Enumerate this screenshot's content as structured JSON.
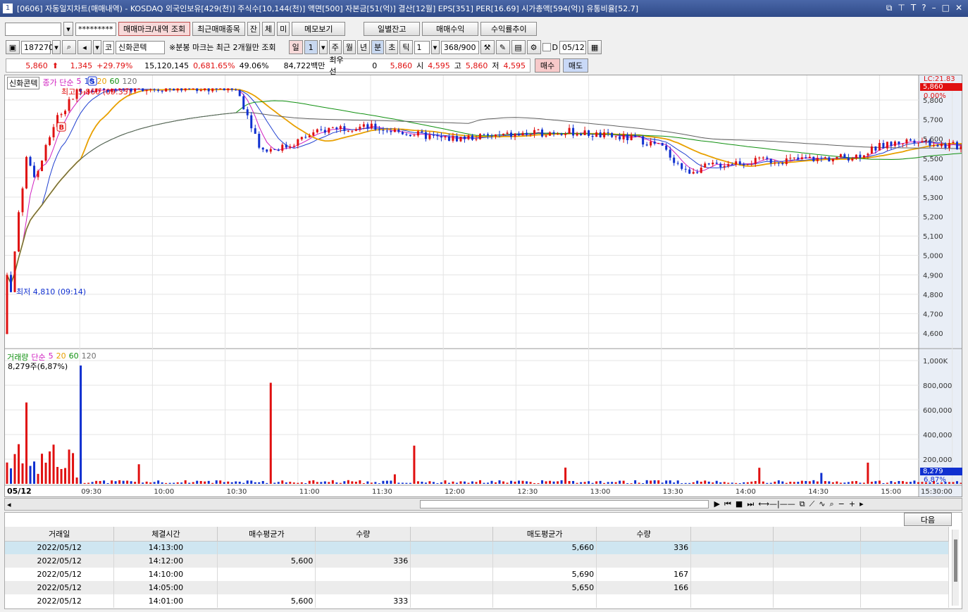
{
  "window": {
    "num": "1",
    "title": "[0606] 자동일지차트(매매내역) - KOSDAQ 외국인보유[429(천)] 주식수[10,144(천)] 액면[500] 자본금[51(억)] 결산[12월] EPS[351] PER[16.69] 시가총액[594(억)] 유통비율[52.7]"
  },
  "toolbar1": {
    "account": "",
    "password": "*********",
    "btn_mark": "매매마크/내역 조회",
    "btn_recent": "최근매매종목",
    "btn_jan": "잔",
    "btn_che": "체",
    "btn_mi": "미",
    "btn_memo": "메모보기",
    "btn_daily": "일별잔고",
    "btn_profit": "매매수익",
    "btn_rate": "수익률추이"
  },
  "toolbar2": {
    "code": "187270",
    "market": "코",
    "name": "신화콘텍",
    "note": "※분봉 마크는 최근 2개월만 조회",
    "periods": [
      "일",
      "1",
      "주",
      "월",
      "년",
      "분",
      "초",
      "틱"
    ],
    "interval": "1",
    "count": "368/900",
    "d_label": "D",
    "date": "05/12"
  },
  "quote": {
    "price": "5,860",
    "change": "1,345",
    "change_pct": "+29.79%",
    "volume": "15,120,145",
    "vol_pct": "0,681.65%",
    "turnover": "49.06%",
    "amount": "84,722백만",
    "best_label": "최우선",
    "best_qty": "0",
    "best_price": "5,860",
    "open_label": "시",
    "open": "4,595",
    "high_label": "고",
    "high": "5,860",
    "low_label": "저",
    "low": "4,595",
    "buy": "매수",
    "sell": "매도"
  },
  "chart": {
    "stock_label": "신화콘텍",
    "price_legend": "종가 단순",
    "ma": [
      "5",
      "10",
      "20",
      "60",
      "120"
    ],
    "high_note": "최고 5,860 (09:35)",
    "low_note": "최저 4,810 (09:14)",
    "lc_label": "LC:21.83",
    "last_price": "5,860",
    "last_pct": "0.00%",
    "price_ticks": [
      "5,800",
      "5,700",
      "5,600",
      "5,500",
      "5,400",
      "5,300",
      "5,200",
      "5,100",
      "5,000",
      "4,900",
      "4,800",
      "4,700",
      "4,600"
    ],
    "vol_legend": "거래량",
    "vol_legend2": "단순",
    "vol_note": "8,279주(6,87%)",
    "vol_ticks": [
      "1,000K",
      "800,000",
      "600,000",
      "400,000",
      "200,000"
    ],
    "vol_last": "8,279",
    "vol_last_pct": "6.87%",
    "date_label": "05/12",
    "time_ticks": [
      "09:30",
      "10:00",
      "10:30",
      "11:00",
      "11:30",
      "12:00",
      "12:30",
      "13:00",
      "13:30",
      "14:00",
      "14:30",
      "15:00",
      "15:30:00"
    ]
  },
  "colors": {
    "up": "#e01010",
    "down": "#1030d0",
    "ma5": "#d020c0",
    "ma10": "#2040d0",
    "ma20": "#e8a000",
    "ma60": "#109010",
    "ma120": "#606060"
  },
  "table": {
    "next": "다음",
    "headers": [
      "거래일",
      "체결시간",
      "매수평균가",
      "수량",
      "",
      "매도평균가",
      "수량",
      "",
      "",
      ""
    ],
    "rows": [
      [
        "2022/05/12",
        "14:13:00",
        "",
        "",
        "",
        "5,660",
        "336",
        "",
        "",
        ""
      ],
      [
        "2022/05/12",
        "14:12:00",
        "5,600",
        "336",
        "",
        "",
        "",
        "",
        "",
        ""
      ],
      [
        "2022/05/12",
        "14:10:00",
        "",
        "",
        "",
        "5,690",
        "167",
        "",
        "",
        ""
      ],
      [
        "2022/05/12",
        "14:05:00",
        "",
        "",
        "",
        "5,650",
        "166",
        "",
        "",
        ""
      ],
      [
        "2022/05/12",
        "14:01:00",
        "5,600",
        "333",
        "",
        "",
        "",
        "",
        "",
        ""
      ]
    ]
  }
}
